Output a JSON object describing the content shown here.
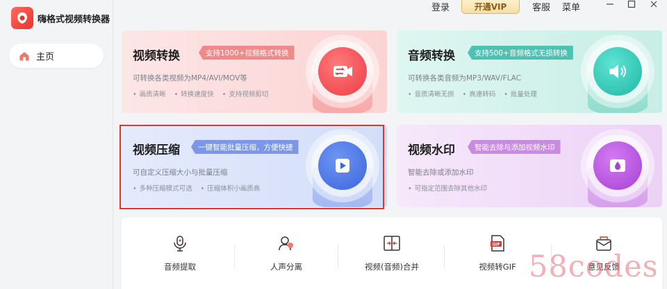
{
  "app": {
    "name": "嗨格式视频转换器"
  },
  "sidebar": {
    "home_label": "主页"
  },
  "topbar": {
    "login": "登录",
    "vip": "开通VIP",
    "service": "客服",
    "menu": "菜单"
  },
  "cards": [
    {
      "title": "视频转换",
      "badge": "支持1000+视频格式转换",
      "desc": "可转换各类视频为MP4/AVI/MOV等",
      "features": [
        "画质清晰",
        "转换速度快",
        "支持视频剪切"
      ]
    },
    {
      "title": "音频转换",
      "badge": "支持500+音频格式无损转换",
      "desc": "可转换各类音频为MP3/WAV/FLAC",
      "features": [
        "音质清晰无损",
        "高速转码",
        "批量处理"
      ]
    },
    {
      "title": "视频压缩",
      "badge": "一键智能批量压缩，方便快捷",
      "desc": "可自定义压缩大小与批量压缩",
      "features": [
        "多种压缩模式可选",
        "压缩体积小画质高"
      ]
    },
    {
      "title": "视频水印",
      "badge": "智能去除与添加视频水印",
      "desc": "智能去除或添加水印",
      "features": [
        "可指定范围去除其他水印"
      ]
    }
  ],
  "tools": [
    {
      "label": "音频提取",
      "icon": "microphone-icon"
    },
    {
      "label": "人声分离",
      "icon": "voice-separation-icon"
    },
    {
      "label": "视频(音频)合并",
      "icon": "merge-icon"
    },
    {
      "label": "视频转GIF",
      "icon": "gif-icon"
    },
    {
      "label": "意见反馈",
      "icon": "mail-icon"
    }
  ],
  "watermark": "58codes",
  "colors": {
    "selected_border": "#e0352b",
    "vip_text": "#8d5c12"
  }
}
